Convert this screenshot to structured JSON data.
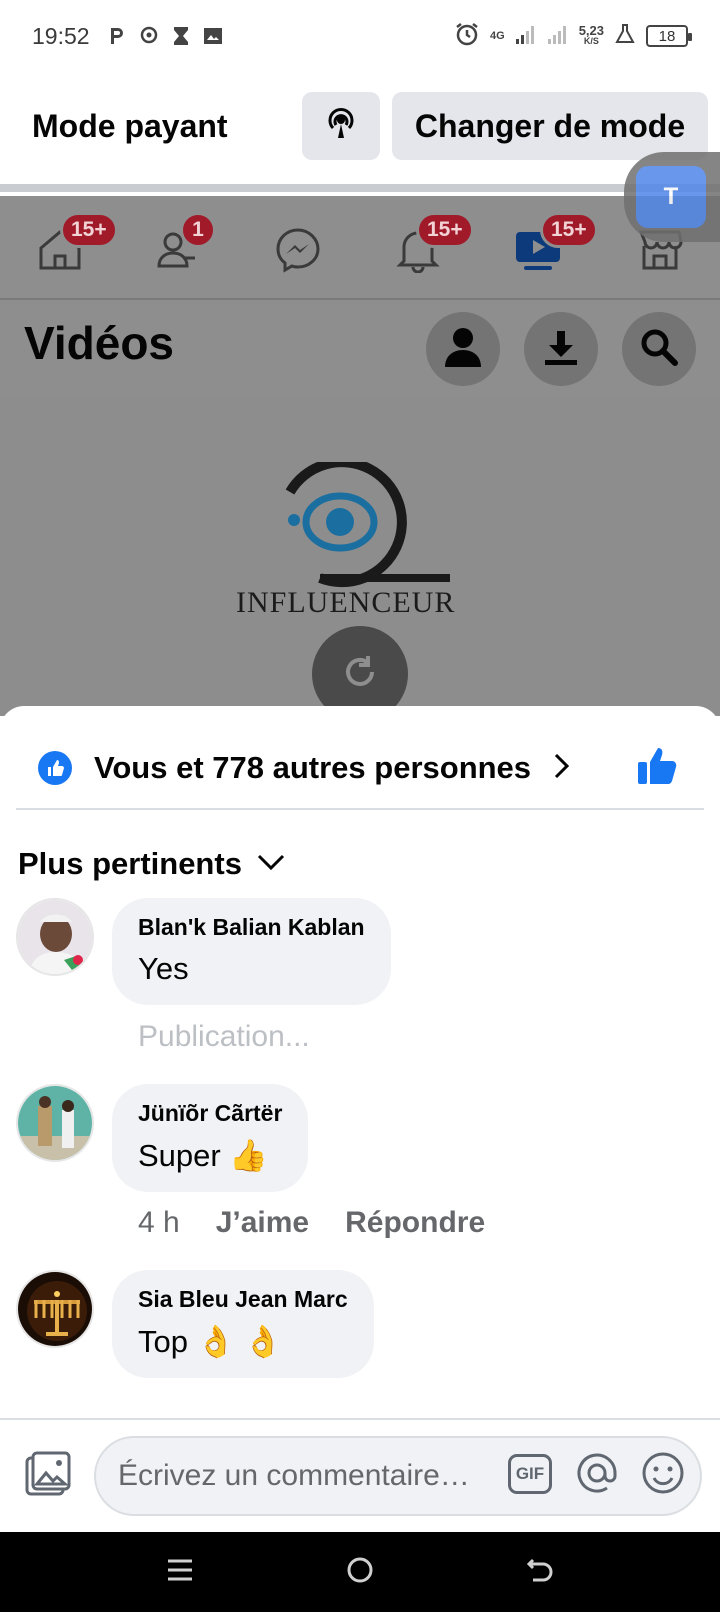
{
  "status_bar": {
    "time": "19:52",
    "network_type": "4G",
    "speed_value": "5,23",
    "speed_unit": "K/S",
    "battery": "18"
  },
  "mode_bar": {
    "title": "Mode payant",
    "change_mode_label": "Changer de mode"
  },
  "tabs": [
    {
      "icon": "home-icon",
      "badge": "15+"
    },
    {
      "icon": "friends-icon",
      "badge": "1"
    },
    {
      "icon": "messenger-icon",
      "badge": ""
    },
    {
      "icon": "bell-icon",
      "badge": "15+"
    },
    {
      "icon": "video-icon",
      "badge": "15+"
    },
    {
      "icon": "marketplace-icon",
      "badge": ""
    }
  ],
  "videos_header": {
    "title": "Vidéos"
  },
  "video": {
    "logo_text": "INFLUENCEUR"
  },
  "translate_widget": {
    "label": "T"
  },
  "reactions": {
    "summary": "Vous et 778 autres personnes"
  },
  "sort": {
    "label": "Plus pertinents"
  },
  "comments": [
    {
      "author": "Blan'k Balian Kablan",
      "text": "Yes",
      "status": "Publication..."
    },
    {
      "author": "Jünïõr Cãrtër",
      "text": "Super 👍",
      "time": "4 h",
      "like_label": "J’aime",
      "reply_label": "Répondre"
    },
    {
      "author": "Sia Bleu Jean Marc",
      "text": "Top 👌 👌"
    }
  ],
  "composer": {
    "placeholder": "Écrivez un commentaire…",
    "gif_label": "GIF"
  },
  "colors": {
    "accent": "#1877f2",
    "badge": "#a01a2a",
    "bubble": "#f0f2f5"
  }
}
